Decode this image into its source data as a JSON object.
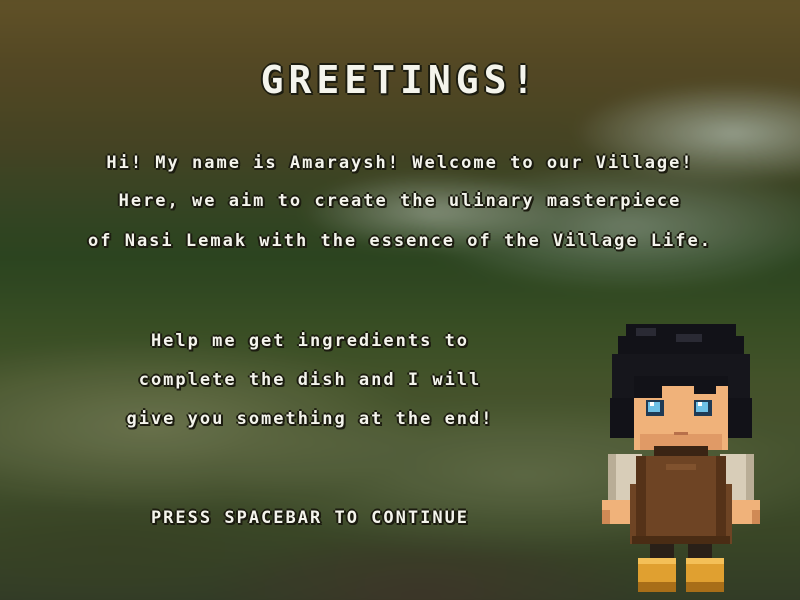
{
  "dialog": {
    "title": "GREETINGS!",
    "intro_lines": [
      "Hi! My name is Amaraysh! Welcome to our Village!",
      "Here, we aim to create the ulinary masterpiece",
      "of Nasi Lemak with the essence of the Village Life."
    ],
    "help_lines": [
      "Help me get ingredients to",
      "complete the dish and I will",
      "give you something at the end!"
    ],
    "continue_prompt": "PRESS SPACEBAR TO CONTINUE"
  },
  "colors": {
    "text": "#f4f4ec",
    "text_outline": "#1c1c10",
    "hair": "#121218",
    "skin": "#f0b27a",
    "tunic": "#6e4424",
    "boots": "#e0a030",
    "eyes": "#6ec0e6"
  },
  "icons": {
    "character": "amaraysh-villager-sprite"
  }
}
